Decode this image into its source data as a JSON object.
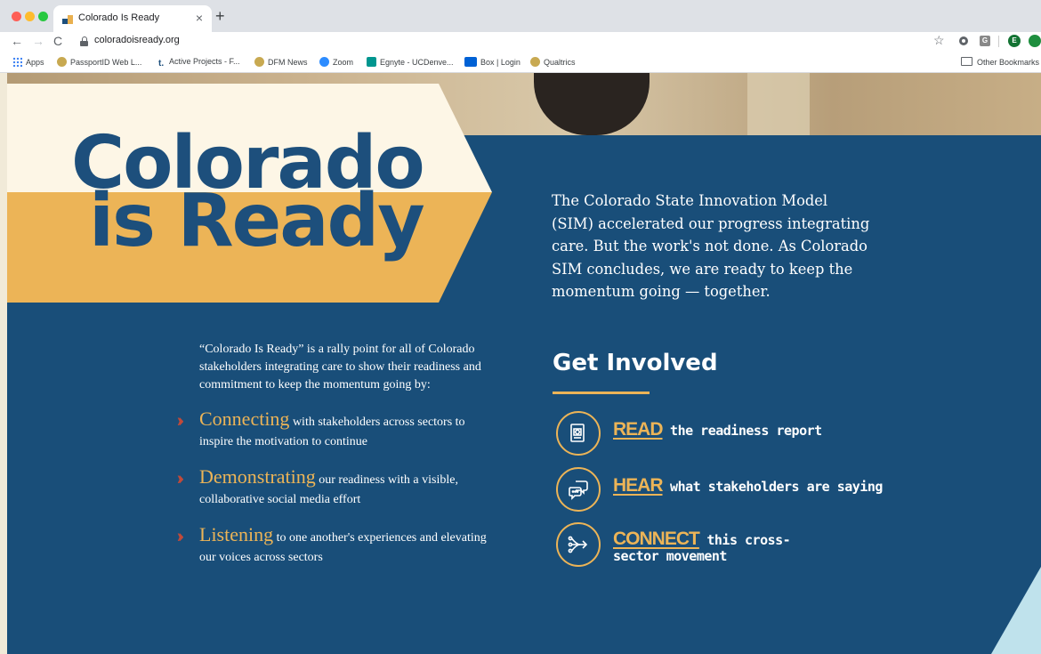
{
  "browser": {
    "tab_title": "Colorado Is Ready",
    "tab_close": "×",
    "new_tab": "+",
    "url": "coloradoisready.org",
    "nav": {
      "back": "←",
      "forward": "→",
      "reload": "C"
    },
    "star": "☆",
    "extensions": [
      "G",
      "E"
    ],
    "bookmarks": [
      {
        "label": "Apps",
        "icon": "apps-grid-icon"
      },
      {
        "label": "PassportID Web L...",
        "icon": "cu-icon"
      },
      {
        "label": "Active Projects - F...",
        "icon": "trello-icon"
      },
      {
        "label": "DFM News",
        "icon": "cu-icon"
      },
      {
        "label": "Zoom",
        "icon": "zoom-icon"
      },
      {
        "label": "Egnyte - UCDenve...",
        "icon": "egnyte-icon"
      },
      {
        "label": "Box | Login",
        "icon": "box-icon"
      },
      {
        "label": "Qualtrics",
        "icon": "cu-icon"
      }
    ],
    "other_bookmarks": "Other Bookmarks"
  },
  "hero": {
    "headline_line1": "Colorado",
    "headline_line2": "is Ready",
    "intro": "The Colorado State Innovation Model (SIM) accelerated our progress integrating care. But the work's not done. As Colorado SIM concludes, we are ready to keep the momentum going — together."
  },
  "rally": {
    "text": "“Colorado Is Ready” is a rally point for all of Colorado stakeholders integrating care to show their readiness and commitment to keep the momentum going by:",
    "items": [
      {
        "keyword": "Connecting",
        "rest": "with stakeholders across sectors to inspire the motivation to continue"
      },
      {
        "keyword": "Demonstrating",
        "rest": "our readiness with a visible, collaborative social media effort"
      },
      {
        "keyword": "Listening",
        "rest": "to one another's experiences and elevating our voices across sectors"
      }
    ]
  },
  "get_involved": {
    "title": "Get Involved",
    "actions": [
      {
        "keyword": "READ",
        "rest": "the readiness report",
        "icon": "document-icon"
      },
      {
        "keyword": "HEAR",
        "rest": "what stakeholders are saying",
        "icon": "speech-bubbles-icon"
      },
      {
        "keyword": "CONNECT",
        "rest": "this cross-sector movement",
        "icon": "network-arrow-icon"
      }
    ]
  },
  "colors": {
    "navy": "#194e79",
    "gold": "#ecb457",
    "cream": "#fdf6e6",
    "chevron_red": "#c24a3a",
    "teal": "#bfe2ec"
  }
}
